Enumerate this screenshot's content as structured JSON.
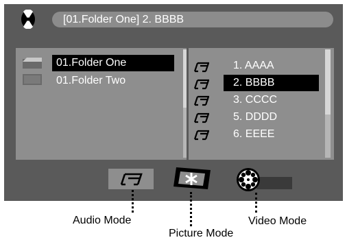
{
  "header": {
    "disc_icon": "disc-icon",
    "title": "[01.Folder One] 2. BBBB"
  },
  "folders": [
    {
      "label": "01.Folder One",
      "selected": true,
      "icon": "open-folder-icon"
    },
    {
      "label": "01.Folder Two",
      "selected": false,
      "icon": "folder-icon"
    }
  ],
  "tracks": [
    {
      "label": "1. AAAA",
      "selected": false,
      "icon": "music-note-icon"
    },
    {
      "label": "2. BBBB",
      "selected": true,
      "icon": "music-note-icon"
    },
    {
      "label": "3. CCCC",
      "selected": false,
      "icon": "music-note-icon"
    },
    {
      "label": "5. DDDD",
      "selected": false,
      "icon": "music-note-icon"
    },
    {
      "label": "6. EEEE",
      "selected": false,
      "icon": "music-note-icon"
    }
  ],
  "modes": {
    "audio_label": "Audio Mode",
    "picture_label": "Picture Mode",
    "video_label": "Video Mode"
  },
  "colors": {
    "screen_bg": "#5a5a5a",
    "panel_bg": "#8e8e8e",
    "highlight": "#000000",
    "text": "#ffffff"
  }
}
